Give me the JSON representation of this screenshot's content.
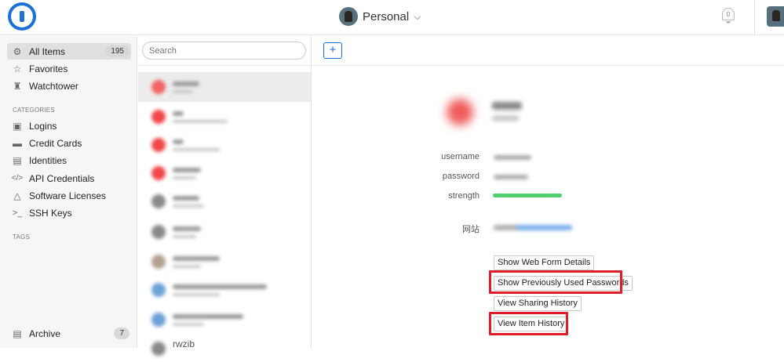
{
  "topbar": {
    "vault_name": "Personal",
    "vault_chevron": "chevron-down-icon",
    "notification_count": "0"
  },
  "sidebar": {
    "items": [
      {
        "label": "All Items",
        "count": "195",
        "icon": "gear-icon",
        "selected": true
      },
      {
        "label": "Favorites",
        "icon": "star-icon"
      },
      {
        "label": "Watchtower",
        "icon": "watchtower-icon"
      }
    ],
    "categories_heading": "CATEGORIES",
    "categories": [
      {
        "label": "Logins",
        "icon": "login-icon"
      },
      {
        "label": "Credit Cards",
        "icon": "credit-card-icon"
      },
      {
        "label": "Identities",
        "icon": "identity-icon"
      },
      {
        "label": "API Credentials",
        "icon": "code-icon"
      },
      {
        "label": "Software Licenses",
        "icon": "software-icon"
      },
      {
        "label": "SSH Keys",
        "icon": "terminal-icon"
      }
    ],
    "tags_heading": "TAGS",
    "archive": {
      "label": "Archive",
      "count": "7",
      "icon": "archive-icon"
    }
  },
  "list": {
    "search_placeholder": "Search",
    "visible_bottom_item_text": "rwzib"
  },
  "detail": {
    "add_label": "+",
    "fields": [
      {
        "label": "username"
      },
      {
        "label": "password"
      },
      {
        "label": "strength",
        "strength_fraction": 1.0
      },
      {
        "label": "网站"
      }
    ],
    "actions": [
      {
        "label": "Show Web Form Details",
        "highlighted": false
      },
      {
        "label": "Show Previously Used Passwords",
        "highlighted": true
      },
      {
        "label": "View Sharing History",
        "highlighted": false
      },
      {
        "label": "View Item History",
        "highlighted": true
      }
    ],
    "colors": {
      "highlight": "#e01b2a",
      "strength": "#4fcf6e",
      "accent": "#1a6fd8"
    }
  }
}
